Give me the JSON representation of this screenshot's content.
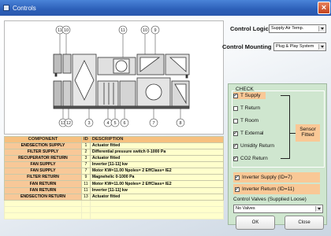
{
  "window": {
    "title": "Controls"
  },
  "controls": {
    "logic_label": "Control Logic",
    "logic_value": "Supply Air Temp.",
    "mounting_label": "Control Mounting",
    "mounting_value": "Plug & Play System"
  },
  "diagram": {
    "callouts_top": [
      "11",
      "10",
      "11",
      "10",
      "9"
    ],
    "callouts_bottom": [
      "13",
      "12",
      "3",
      "4",
      "5",
      "6",
      "7",
      "8"
    ]
  },
  "table": {
    "headers": [
      "COMPONENT",
      "ID",
      "DESCRIPTION"
    ],
    "rows": [
      {
        "component": "ENDSECTION SUPPLY",
        "id": "1",
        "description": "Actuator fitted"
      },
      {
        "component": "FILTER SUPPLY",
        "id": "2",
        "description": "Differential pressure switch 0-1000 Pa"
      },
      {
        "component": "RECUPERATOR RETURN",
        "id": "3",
        "description": "Actuator fitted"
      },
      {
        "component": "FAN SUPPLY",
        "id": "7",
        "description": "Inverter [11-11] kw"
      },
      {
        "component": "FAN SUPPLY",
        "id": "7",
        "description": "Motor KW=11.00 Npoles= 2 EffClass= IE2"
      },
      {
        "component": "FILTER RETURN",
        "id": "9",
        "description": "Magnehelic 0-1000 Pa"
      },
      {
        "component": "FAN RETURN",
        "id": "11",
        "description": "Motor KW=11.00 Npoles= 2 EffClass= IE2"
      },
      {
        "component": "FAN RETURN",
        "id": "11",
        "description": "Inverter [11-11] kw"
      },
      {
        "component": "ENDSECTION RETURN",
        "id": "13",
        "description": "Actuator fitted"
      }
    ]
  },
  "check": {
    "legend": "CHECK",
    "items": [
      {
        "label": "T Supply",
        "checked": true
      },
      {
        "label": "T Return",
        "checked": false
      },
      {
        "label": "T Room",
        "checked": false
      },
      {
        "label": "T External",
        "checked": true
      },
      {
        "label": "Umidity Return",
        "checked": true
      },
      {
        "label": "CO2 Return",
        "checked": true
      }
    ],
    "sensor_line1": "Sensor",
    "sensor_line2": "Fitted",
    "inverter_supply": "Inverter Supply (ID=7)",
    "inverter_return": "Inverter Return (ID=11)",
    "valves_label": "Control Valves (Supplied Loose)",
    "valves_value": "No Valves"
  },
  "buttons": {
    "ok": "OK",
    "close": "Close"
  },
  "colors": {
    "title_bar": "#2c5fb8",
    "highlight": "#f9c896",
    "check_panel": "#cfe6cf",
    "table_bg": "#ffffcc",
    "table_header": "#f6c07f"
  }
}
